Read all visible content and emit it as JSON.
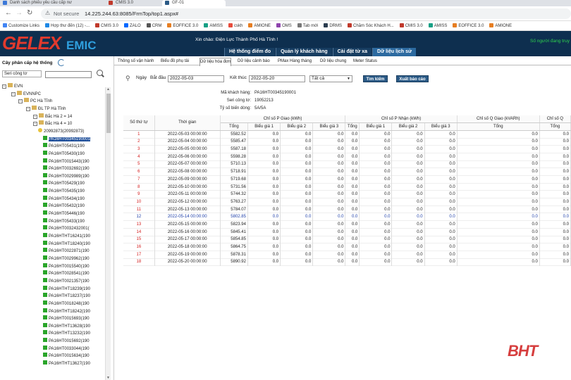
{
  "browser": {
    "tabs": [
      {
        "label": "Danh sách phiếu yêu cầu cấp nư",
        "active": false,
        "color": "#3c78d8"
      },
      {
        "label": "CMIS 3.0",
        "active": false,
        "color": "#c0392b"
      },
      {
        "label": "GF-01",
        "active": true,
        "color": "#2b5a86"
      }
    ],
    "not_secure": "Not secure",
    "url": "14.225.244.63:8085/FrmTop/top1.aspx#",
    "bookmarks": [
      {
        "label": "Customize Links",
        "color": "#4285f4"
      },
      {
        "label": "Hợp thư đến (12) -...",
        "color": "#1e88e5"
      },
      {
        "label": "CMIS 3.0",
        "color": "#c0392b"
      },
      {
        "label": "ZALO",
        "color": "#0068ff"
      },
      {
        "label": "CRM",
        "color": "#555"
      },
      {
        "label": "EOFFICE 3.0",
        "color": "#e67e22"
      },
      {
        "label": "AMISS",
        "color": "#16a085"
      },
      {
        "label": "cskh",
        "color": "#e74c3c"
      },
      {
        "label": "AMIONE",
        "color": "#e67e22"
      },
      {
        "label": "OMS",
        "color": "#8e44ad"
      },
      {
        "label": "Tab mới",
        "color": "#777"
      },
      {
        "label": "DRMS",
        "color": "#2c3e50"
      },
      {
        "label": "Chăm Sóc Khách H...",
        "color": "#c0392b"
      },
      {
        "label": "CMIS 3.0",
        "color": "#c0392b"
      },
      {
        "label": "AMISS",
        "color": "#16a085"
      },
      {
        "label": "EOFFICE 3.0",
        "color": "#e67e22"
      },
      {
        "label": "AMIONE",
        "color": "#e67e22"
      }
    ]
  },
  "header": {
    "logo_part1": "GELEX",
    "logo_part2": "EMIC",
    "greeting": "Xin chào: Điện Lực Thành Phố Hà Tĩnh !",
    "userinfo": "Số người đang truy",
    "menu": [
      {
        "label": "Hệ thống điểm đo",
        "active": false
      },
      {
        "label": "Quản lý khách hàng",
        "active": false
      },
      {
        "label": "Cài đặt từ xa",
        "active": false
      },
      {
        "label": "Dữ liệu lịch sử",
        "active": true
      }
    ]
  },
  "subtabs": [
    {
      "label": "Thông số vận hành",
      "active": false
    },
    {
      "label": "Biểu đồ phụ tải",
      "active": false
    },
    {
      "label": "Dữ liệu hóa đơn",
      "active": true
    },
    {
      "label": "Dữ liệu cảnh báo",
      "active": false
    },
    {
      "label": "PMax Hàng tháng",
      "active": false
    },
    {
      "label": "Dữ liệu chung",
      "active": false
    },
    {
      "label": "Meter Status",
      "active": false
    }
  ],
  "sidebar": {
    "title": "Cây phân cấp hệ thống",
    "select_value": "Seri công tơ",
    "search_value": "",
    "tree": [
      {
        "label": "EVN",
        "level": 0,
        "type": "exp"
      },
      {
        "label": "EVNNPC",
        "level": 1,
        "type": "exp"
      },
      {
        "label": "PC Hà Tĩnh",
        "level": 2,
        "type": "exp"
      },
      {
        "label": "ĐL TP Hà Tĩnh",
        "level": 3,
        "type": "exp"
      },
      {
        "label": "Bắc Hà 2 = 14",
        "level": 4,
        "type": "exp"
      },
      {
        "label": "Bắc Hà 4 = 10",
        "level": 4,
        "type": "exp"
      },
      {
        "label": "20992873(20992873)",
        "level": 5,
        "type": "folder"
      },
      {
        "label": "PA16HT00345190001",
        "level": 6,
        "type": "meter",
        "selected": true
      },
      {
        "label": "PA16HT05431(190",
        "level": 6,
        "type": "meter"
      },
      {
        "label": "PA16HT05430(190",
        "level": 6,
        "type": "meter"
      },
      {
        "label": "PA16HT0015443(190",
        "level": 6,
        "type": "meter"
      },
      {
        "label": "PA16HT0032692(190",
        "level": 6,
        "type": "meter"
      },
      {
        "label": "PA16HT0029989(190",
        "level": 6,
        "type": "meter"
      },
      {
        "label": "PA16HT05429(190",
        "level": 6,
        "type": "meter"
      },
      {
        "label": "PA16HT05435(190",
        "level": 6,
        "type": "meter"
      },
      {
        "label": "PA16HT05434(190",
        "level": 6,
        "type": "meter"
      },
      {
        "label": "PA16HT05432(190",
        "level": 6,
        "type": "meter"
      },
      {
        "label": "PA16HT05446(190",
        "level": 6,
        "type": "meter"
      },
      {
        "label": "PA16HT05433(190",
        "level": 6,
        "type": "meter"
      },
      {
        "label": "PA16HT0032432001(",
        "level": 6,
        "type": "meter"
      },
      {
        "label": "PA16HTHT16241(190",
        "level": 6,
        "type": "meter"
      },
      {
        "label": "PA16HTHT18240(190",
        "level": 6,
        "type": "meter"
      },
      {
        "label": "PA16HT0022871(190",
        "level": 6,
        "type": "meter"
      },
      {
        "label": "PA16HT0029962(190",
        "level": 6,
        "type": "meter"
      },
      {
        "label": "PA16HT0015540(190",
        "level": 6,
        "type": "meter"
      },
      {
        "label": "PA16HT0028541(190",
        "level": 6,
        "type": "meter"
      },
      {
        "label": "PA16HT0021357(190",
        "level": 6,
        "type": "meter"
      },
      {
        "label": "PA16HTHT18239(190",
        "level": 6,
        "type": "meter"
      },
      {
        "label": "PA16HTHT18237(190",
        "level": 6,
        "type": "meter"
      },
      {
        "label": "PA16HT0018248(190",
        "level": 6,
        "type": "meter"
      },
      {
        "label": "PA16HTHT18242(190",
        "level": 6,
        "type": "meter"
      },
      {
        "label": "PA16HT0015693(190",
        "level": 6,
        "type": "meter"
      },
      {
        "label": "PA16HTHT13628(190",
        "level": 6,
        "type": "meter"
      },
      {
        "label": "PA16HTHT13232(190",
        "level": 6,
        "type": "meter"
      },
      {
        "label": "PA16HT0015692(190",
        "level": 6,
        "type": "meter"
      },
      {
        "label": "PA16HT0033044(190",
        "level": 6,
        "type": "meter"
      },
      {
        "label": "PA16HT0015634(190",
        "level": 6,
        "type": "meter"
      },
      {
        "label": "PA16HTHT13627(190",
        "level": 6,
        "type": "meter"
      }
    ]
  },
  "filter": {
    "day_label": "Ngày",
    "start_label": "Bắt đầu",
    "start_value": "2022-05-03",
    "end_label": "Kết thúc",
    "end_value": "2022-05-20",
    "select_value": "Tất cả",
    "search_button": "Tìm kiếm",
    "export_button": "Xuất báo cáo"
  },
  "customer": {
    "code_label": "Mã khách hàng:",
    "code_value": "PA16HT00345190001",
    "serial_label": "Seri công tơ:",
    "serial_value": "19052213",
    "ratio_label": "Tỷ số biến dòng:",
    "ratio_value": "5A/5A"
  },
  "table": {
    "col_stt": "Số thứ tự",
    "col_time": "Thời gian",
    "group_p_giao": "Chỉ số P Giao (kWh)",
    "group_p_nhan": "Chỉ số P Nhận (kWh)",
    "group_q_giao": "Chỉ số Q Giao (kVARh)",
    "group_q_next": "Chỉ số Q",
    "sub_total": "Tổng",
    "sub_b1": "Biểu giá 1",
    "sub_b2": "Biểu giá 2",
    "sub_b3": "Biểu giá 3",
    "rows": [
      {
        "stt": "1",
        "time": "2022-05-03 00:00:00",
        "total": "5582.52"
      },
      {
        "stt": "2",
        "time": "2022-05-04 00:00:00",
        "total": "5585.47"
      },
      {
        "stt": "3",
        "time": "2022-05-05 00:00:00",
        "total": "5587.18"
      },
      {
        "stt": "4",
        "time": "2022-05-06 00:00:00",
        "total": "5598.28"
      },
      {
        "stt": "5",
        "time": "2022-05-07 00:00:00",
        "total": "5710.13"
      },
      {
        "stt": "6",
        "time": "2022-05-08 00:00:00",
        "total": "5718.91"
      },
      {
        "stt": "7",
        "time": "2022-05-09 00:00:00",
        "total": "5719.68"
      },
      {
        "stt": "8",
        "time": "2022-05-10 00:00:00",
        "total": "5731.56"
      },
      {
        "stt": "9",
        "time": "2022-05-11 00:00:00",
        "total": "5744.32"
      },
      {
        "stt": "10",
        "time": "2022-05-12 00:00:00",
        "total": "5763.27"
      },
      {
        "stt": "11",
        "time": "2022-05-13 00:00:00",
        "total": "5784.07"
      },
      {
        "stt": "12",
        "time": "2022-05-14 00:00:00",
        "total": "5802.85",
        "highlight": true
      },
      {
        "stt": "13",
        "time": "2022-05-15 00:00:00",
        "total": "5823.94"
      },
      {
        "stt": "14",
        "time": "2022-05-16 00:00:00",
        "total": "5845.41"
      },
      {
        "stt": "15",
        "time": "2022-05-17 00:00:00",
        "total": "5854.85"
      },
      {
        "stt": "16",
        "time": "2022-05-18 00:00:00",
        "total": "5864.75"
      },
      {
        "stt": "17",
        "time": "2022-05-19 00:00:00",
        "total": "5878.31"
      },
      {
        "stt": "18",
        "time": "2022-05-20 00:00:00",
        "total": "5890.92"
      }
    ],
    "zero": "0.0",
    "zero_q": "0.0"
  },
  "watermark": "BHT"
}
